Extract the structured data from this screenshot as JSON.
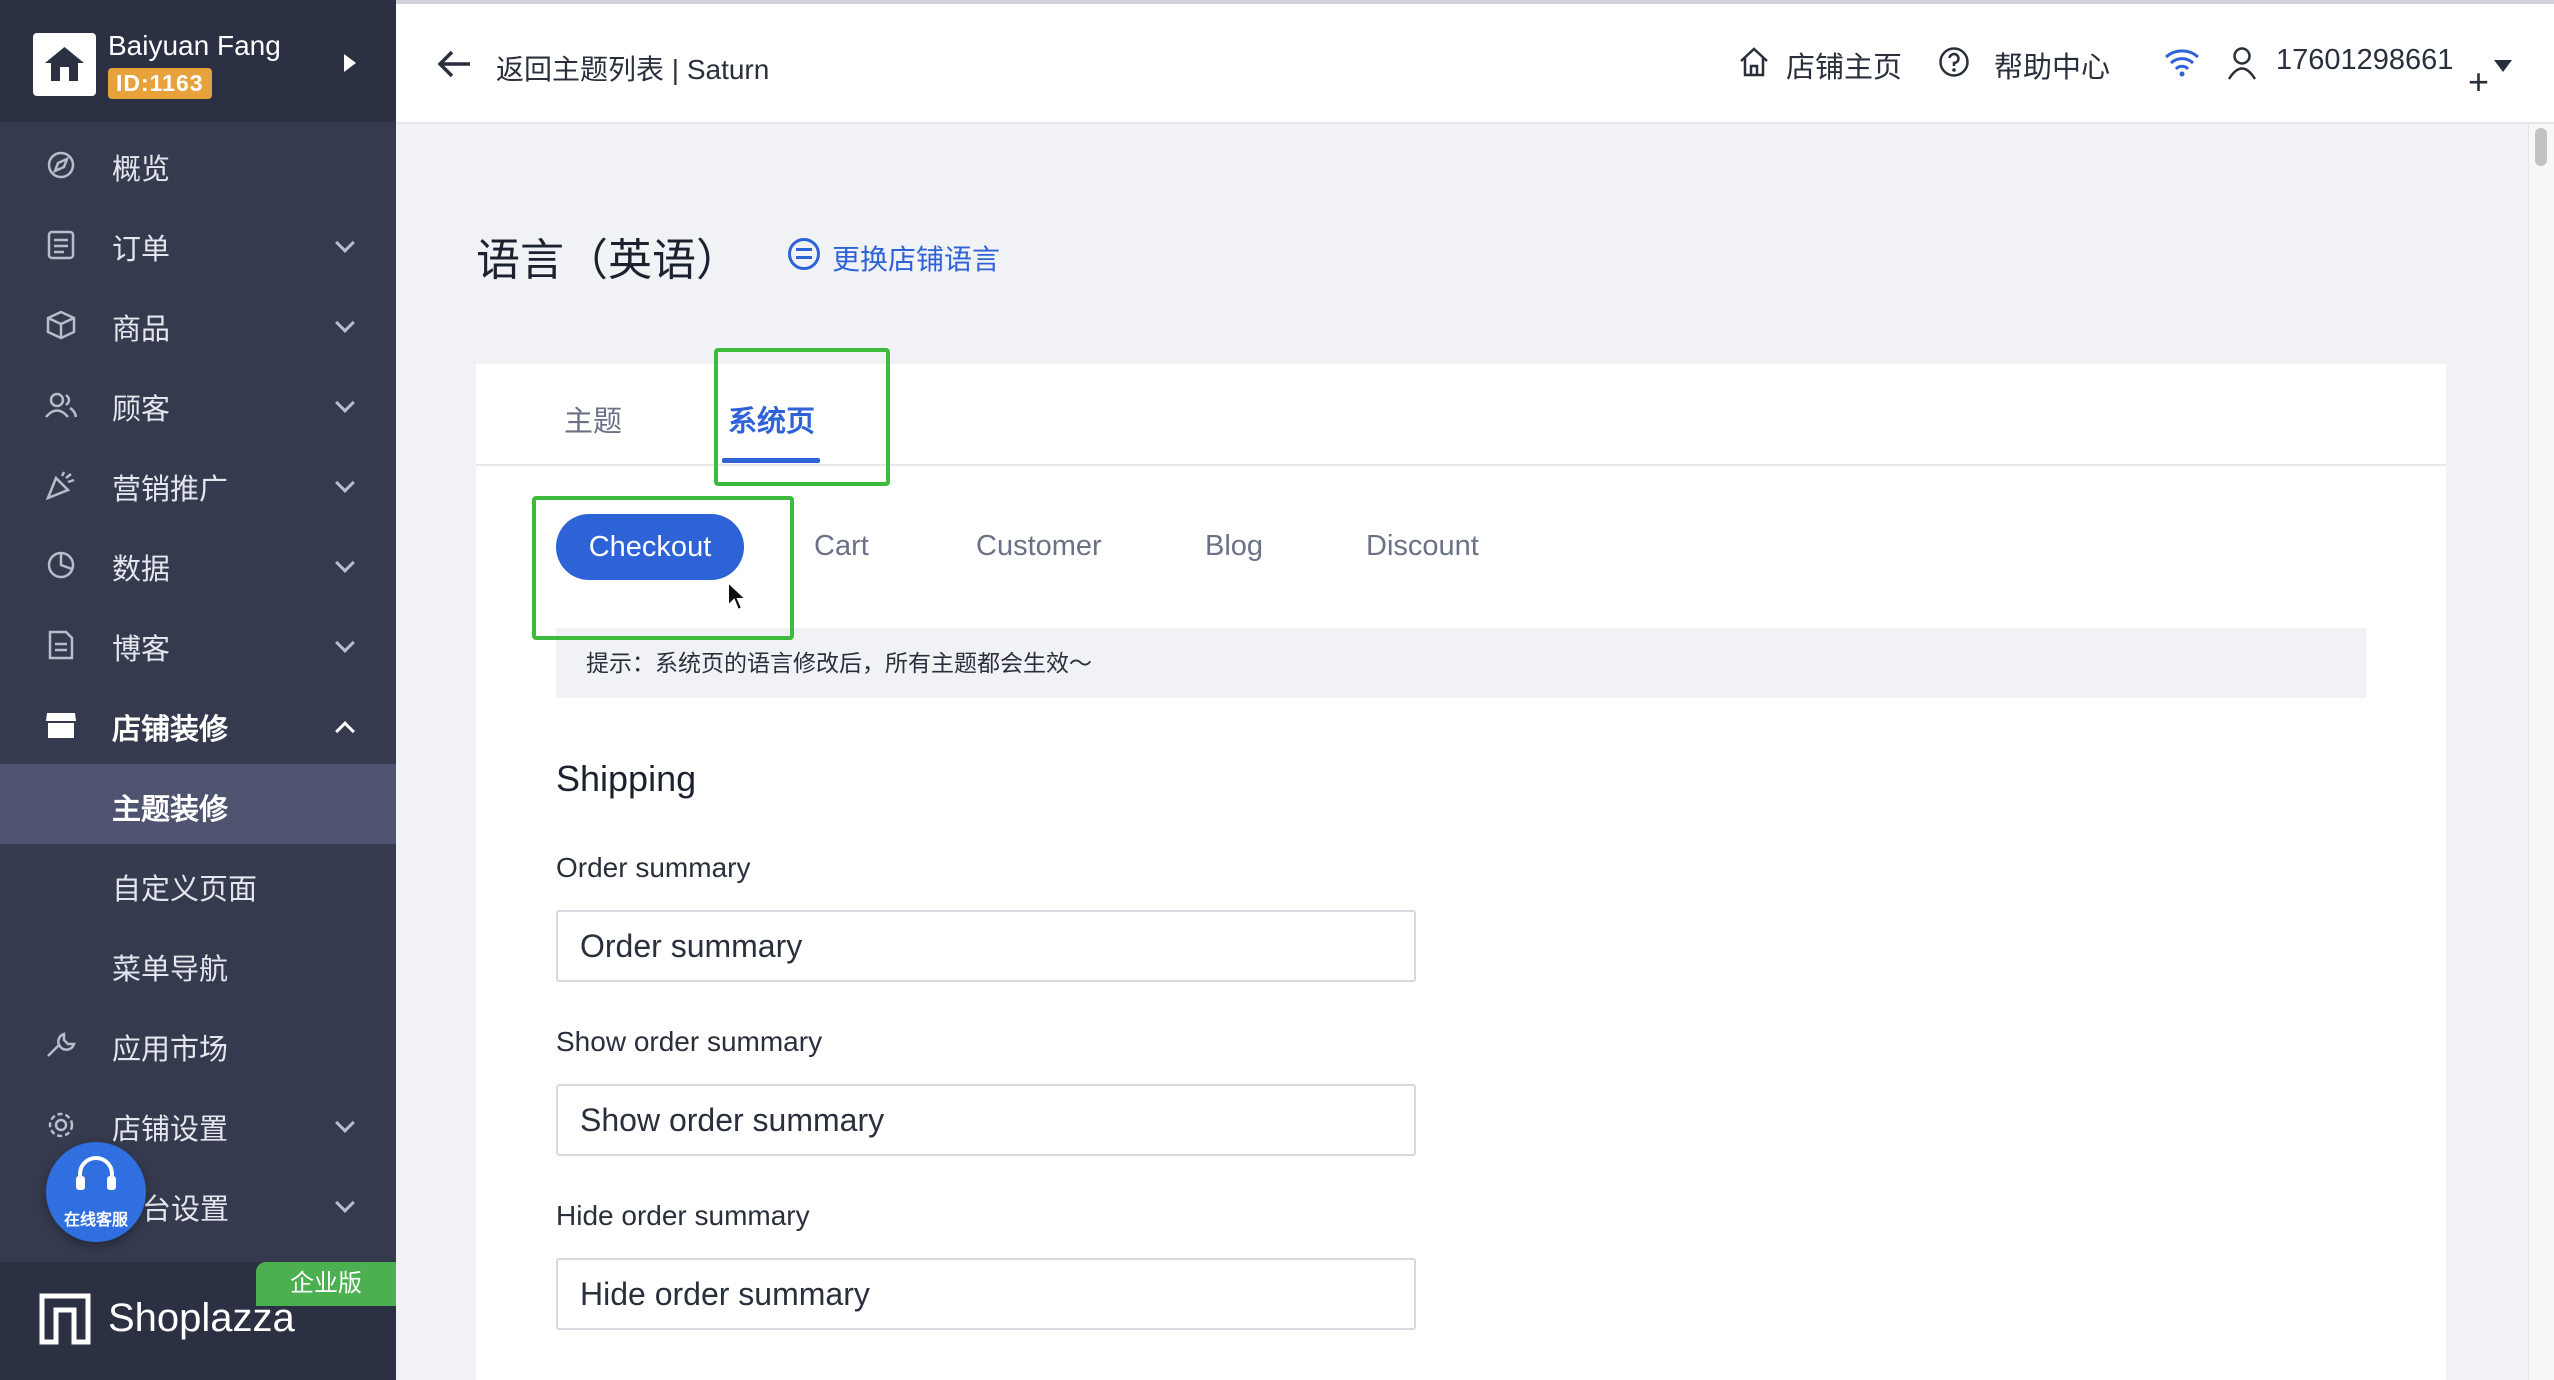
{
  "sidebar": {
    "user_name": "Baiyuan Fang",
    "user_id": "ID:1163",
    "items": [
      {
        "label": "概览",
        "icon": "compass-icon"
      },
      {
        "label": "订单",
        "icon": "order-icon"
      },
      {
        "label": "商品",
        "icon": "box-icon"
      },
      {
        "label": "顾客",
        "icon": "users-icon"
      },
      {
        "label": "营销推广",
        "icon": "megaphone-icon"
      },
      {
        "label": "数据",
        "icon": "pie-chart-icon"
      },
      {
        "label": "博客",
        "icon": "document-icon"
      },
      {
        "label": "店铺装修",
        "icon": "store-icon"
      },
      {
        "label": "主题装修"
      },
      {
        "label": "自定义页面"
      },
      {
        "label": "菜单导航"
      },
      {
        "label": "应用市场",
        "icon": "wrench-icon"
      },
      {
        "label": "店铺设置",
        "icon": "gear-icon"
      },
      {
        "label": "台设置",
        "icon": "platform-icon"
      }
    ],
    "support_label": "在线客服",
    "edition_badge": "企业版",
    "brand": "Shoplazza"
  },
  "topbar": {
    "back_text": "返回主题列表 | Saturn",
    "store_home": "店铺主页",
    "help_center": "帮助中心",
    "account": "17601298661"
  },
  "main": {
    "title": "语言（英语）",
    "switch_language": "更换店铺语言",
    "tabs": [
      {
        "label": "主题"
      },
      {
        "label": "系统页"
      }
    ],
    "subtabs": [
      {
        "label": "Checkout"
      },
      {
        "label": "Cart"
      },
      {
        "label": "Customer"
      },
      {
        "label": "Blog"
      },
      {
        "label": "Discount"
      }
    ],
    "hint": "提示：系统页的语言修改后，所有主题都会生效～",
    "section_title": "Shipping",
    "fields": [
      {
        "label": "Order summary",
        "value": "Order summary"
      },
      {
        "label": "Show order summary",
        "value": "Show order summary"
      },
      {
        "label": "Hide order summary",
        "value": "Hide order summary"
      }
    ]
  },
  "colors": {
    "accent": "#2e63d8",
    "sidebar_bg": "#353a4e",
    "highlight": "#3dbb3d",
    "badge_orange": "#e8a23b",
    "enterprise_green": "#4caf50"
  }
}
